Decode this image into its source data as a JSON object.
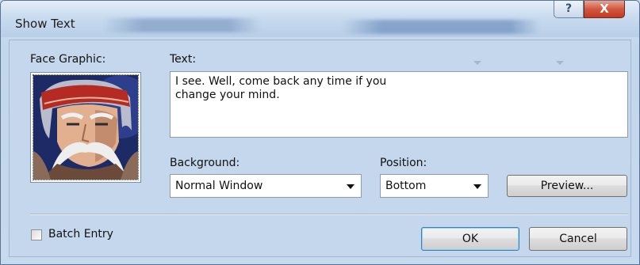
{
  "window": {
    "title": "Show Text",
    "help_glyph": "?",
    "close_glyph": "X"
  },
  "face_graphic": {
    "label": "Face Graphic:",
    "icon": "portrait-image"
  },
  "text": {
    "label": "Text:",
    "lines": [
      "I see. Well, come back any time if you",
      "change your mind."
    ]
  },
  "background": {
    "label": "Background:",
    "selected": "Normal Window"
  },
  "position": {
    "label": "Position:",
    "selected": "Bottom"
  },
  "buttons": {
    "preview": "Preview...",
    "ok": "OK",
    "cancel": "Cancel"
  },
  "batch_entry": {
    "label": "Batch Entry",
    "checked": false
  },
  "colors": {
    "close_red": "#c23a22",
    "dialog_blue": "#c5d7ed"
  }
}
